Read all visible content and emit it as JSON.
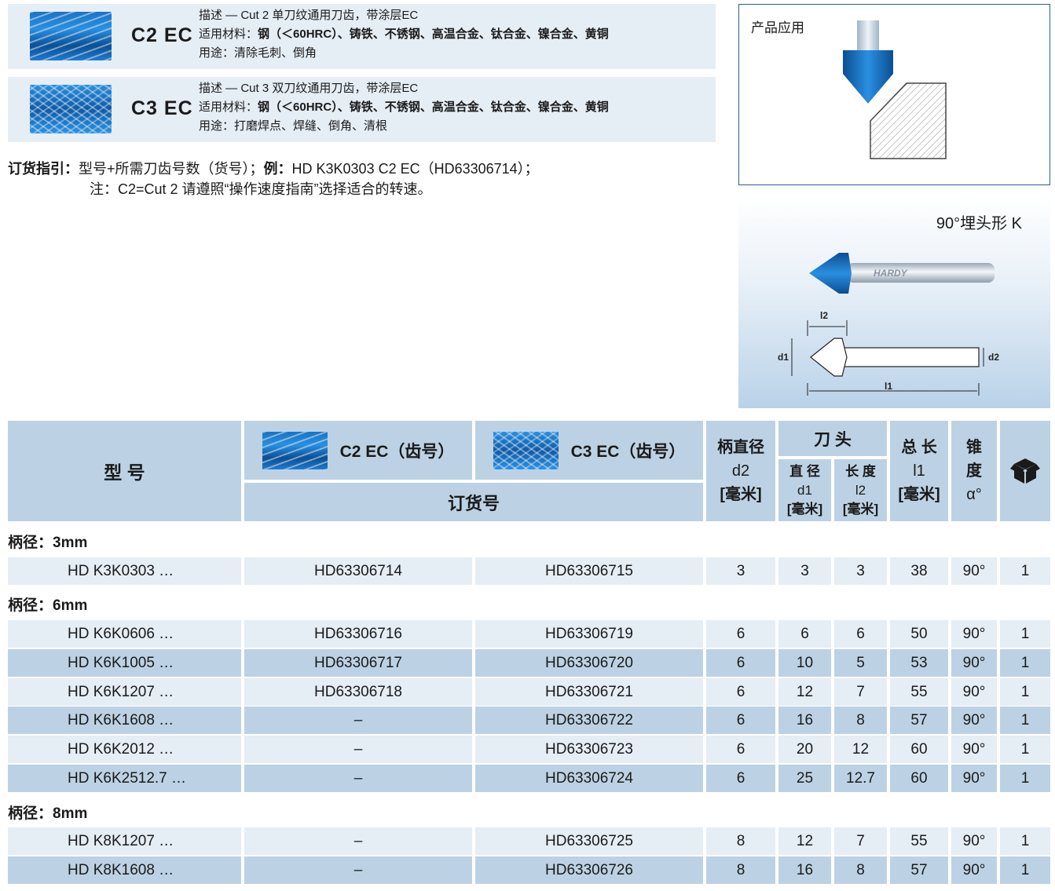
{
  "cards": [
    {
      "code": "C2 EC",
      "desc": "描述 — Cut 2 单刀纹通用刀齿，带涂层EC",
      "material_label": "适用材料：",
      "material": "钢（＜60HRC）、铸铁、不锈钢、高温合金、钛合金、镍合金、黄铜",
      "usage": "用途：清除毛刺、倒角"
    },
    {
      "code": "C3 EC",
      "desc": "描述 — Cut 3 双刀纹通用刀齿，带涂层EC",
      "material_label": "适用材料：",
      "material": "钢（＜60HRC）、铸铁、不锈钢、高温合金、钛合金、镍合金、黄铜",
      "usage": "用途：打磨焊点、焊缝、倒角、清根"
    }
  ],
  "order_guide": {
    "label": "订货指引：",
    "text1": "型号+所需刀齿号数（货号）；",
    "example_label": "例：",
    "example": "HD K3K0303 C2 EC（HD63306714）；",
    "note": "注：C2=Cut 2  请遵照“操作速度指南”选择适合的转速。"
  },
  "application": {
    "title": "产品应用"
  },
  "tool_panel": {
    "title": "90°埋头形 K",
    "brand": "HARDY",
    "dim_l2": "l2",
    "dim_d1": "d1",
    "dim_d2": "d2",
    "dim_l1": "l1"
  },
  "table": {
    "header": {
      "model": "型 号",
      "c2": "C2 EC（齿号）",
      "c3": "C3 EC（齿号）",
      "order_no": "订货号",
      "shank": [
        "柄直径",
        "d2",
        "[毫米]"
      ],
      "head": "刀 头",
      "dia": [
        "直 径",
        "d1",
        "[毫米]"
      ],
      "len": [
        "长 度",
        "l2",
        "[毫米]"
      ],
      "total": [
        "总 长",
        "l1",
        "[毫米]"
      ],
      "angle": [
        "锥",
        "度",
        "α°"
      ],
      "pack_icon": "package-icon"
    },
    "groups": [
      {
        "title": "柄径：3mm",
        "rows": [
          [
            "HD K3K0303 …",
            "HD63306714",
            "HD63306715",
            "3",
            "3",
            "3",
            "38",
            "90°",
            "1"
          ]
        ]
      },
      {
        "title": "柄径：6mm",
        "rows": [
          [
            "HD K6K0606 …",
            "HD63306716",
            "HD63306719",
            "6",
            "6",
            "6",
            "50",
            "90°",
            "1"
          ],
          [
            "HD K6K1005 …",
            "HD63306717",
            "HD63306720",
            "6",
            "10",
            "5",
            "53",
            "90°",
            "1"
          ],
          [
            "HD K6K1207 …",
            "HD63306718",
            "HD63306721",
            "6",
            "12",
            "7",
            "55",
            "90°",
            "1"
          ],
          [
            "HD K6K1608 …",
            "–",
            "HD63306722",
            "6",
            "16",
            "8",
            "57",
            "90°",
            "1"
          ],
          [
            "HD K6K2012 …",
            "–",
            "HD63306723",
            "6",
            "20",
            "12",
            "60",
            "90°",
            "1"
          ],
          [
            "HD K6K2512.7 …",
            "–",
            "HD63306724",
            "6",
            "25",
            "12.7",
            "60",
            "90°",
            "1"
          ]
        ]
      },
      {
        "title": "柄径：8mm",
        "rows": [
          [
            "HD K8K1207 …",
            "–",
            "HD63306725",
            "8",
            "12",
            "7",
            "55",
            "90°",
            "1"
          ],
          [
            "HD K8K1608 …",
            "–",
            "HD63306726",
            "8",
            "16",
            "8",
            "57",
            "90°",
            "1"
          ]
        ]
      }
    ]
  },
  "colors": {
    "header_bg": "#bcd2e4",
    "row_light": "#e5edf5",
    "row_dark": "#bcd2e4",
    "tool_blue": "#1f6fc0",
    "frame_blue": "#2b5f96"
  }
}
